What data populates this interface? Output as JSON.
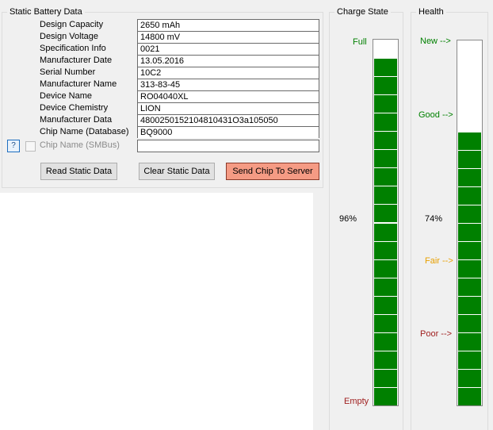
{
  "static_group": {
    "title": "Static Battery Data",
    "fields": [
      {
        "label": "Design Capacity",
        "value": "2650 mAh"
      },
      {
        "label": "Design Voltage",
        "value": "14800 mV"
      },
      {
        "label": "Specification Info",
        "value": "0021"
      },
      {
        "label": "Manufacturer Date",
        "value": "13.05.2016"
      },
      {
        "label": "Serial Number",
        "value": "10C2"
      },
      {
        "label": "Manufacturer Name",
        "value": "313-83-45"
      },
      {
        "label": "Device Name",
        "value": "RO04040XL"
      },
      {
        "label": "Device Chemistry",
        "value": "LION"
      },
      {
        "label": "Manufacturer Data",
        "value": "4800250152104810431O3a105050"
      },
      {
        "label": "Chip Name (Database)",
        "value": "BQ9000"
      },
      {
        "label": "Chip Name (SMBus)",
        "value": ""
      }
    ],
    "help_label": "?",
    "buttons": {
      "read": "Read Static Data",
      "clear": "Clear Static Data",
      "send": "Send Chip To Server"
    }
  },
  "charge_state": {
    "title": "Charge State",
    "top_label": "Full",
    "bottom_label": "Empty",
    "percent_text": "96%",
    "level": 0.96,
    "segments": 20,
    "bar_color": "#008000"
  },
  "health": {
    "title": "Health",
    "markers": {
      "new": "New -->",
      "good": "Good -->",
      "fair": "Fair -->",
      "poor": "Poor -->"
    },
    "percent_text": "74%",
    "level": 0.74,
    "segments": 20,
    "bar_color": "#008000",
    "colors": {
      "new": "#008000",
      "good": "#008000",
      "fair": "#e8a000",
      "poor": "#a02020"
    }
  }
}
